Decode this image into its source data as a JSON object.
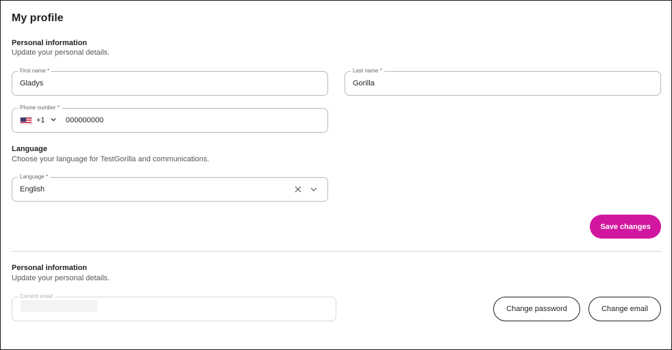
{
  "page": {
    "title": "My profile"
  },
  "personal": {
    "title": "Personal information",
    "subtitle": "Update your personal details.",
    "first_name": {
      "label": "First name *",
      "value": "Gladys"
    },
    "last_name": {
      "label": "Last name *",
      "value": "Gorilla"
    },
    "phone": {
      "label": "Phone number *",
      "country_flag": "us-flag-icon",
      "dial_code": "+1",
      "value": "000000000"
    }
  },
  "language": {
    "title": "Language",
    "subtitle": "Choose your language for TestGorilla and communications.",
    "field_label": "Language *",
    "value": "English"
  },
  "actions": {
    "save_label": "Save changes",
    "accent_color": "#d1179f"
  },
  "account": {
    "title": "Personal information",
    "subtitle": "Update your personal details.",
    "email_label": "Current email",
    "change_password_label": "Change password",
    "change_email_label": "Change email"
  }
}
